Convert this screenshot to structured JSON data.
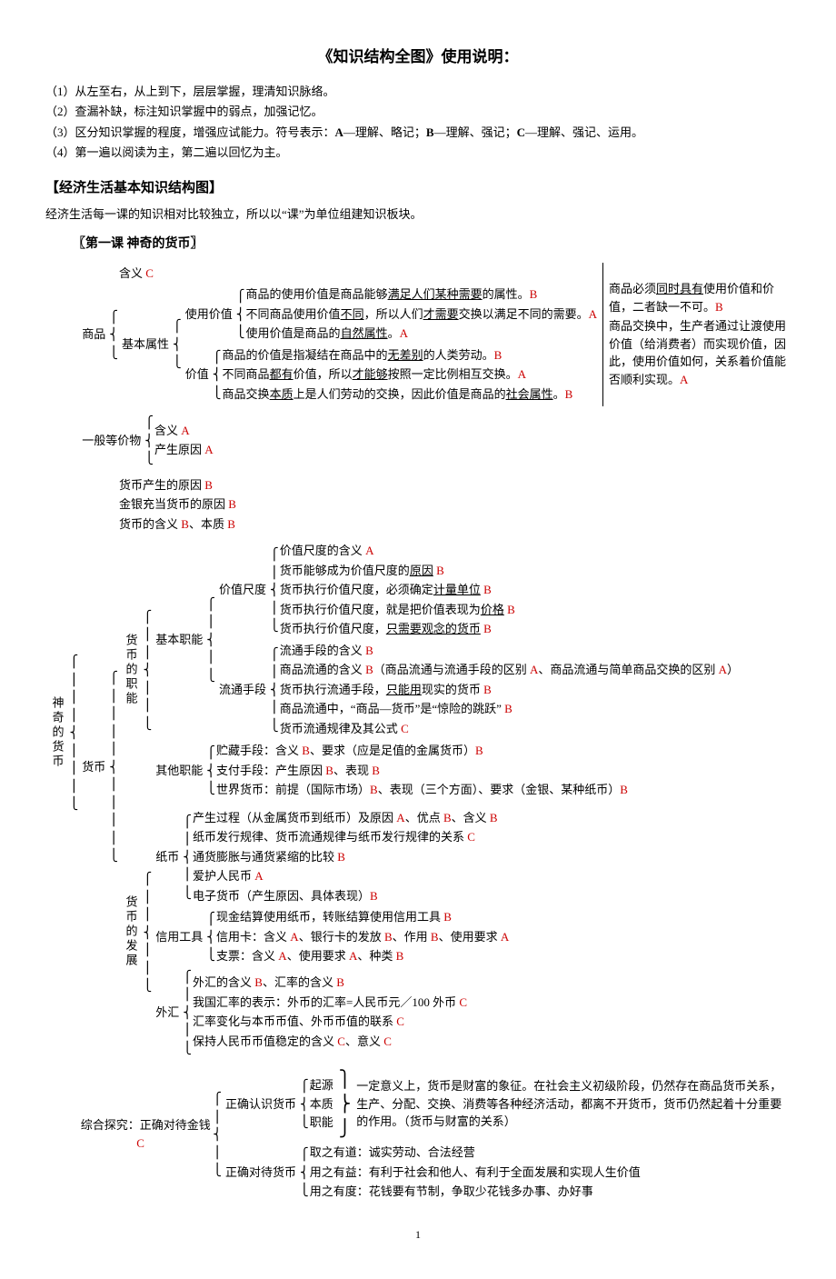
{
  "title": "《知识结构全图》使用说明：",
  "intro": {
    "l1": "（1）从左至右，从上到下，层层掌握，理清知识脉络。",
    "l2": "（2）查漏补缺，标注知识掌握中的弱点，加强记忆。",
    "l3_a": "（3）区分知识掌握的程度，增强应试能力。符号表示：",
    "l3_b": "A",
    "l3_c": "—理解、略记；",
    "l3_d": "B",
    "l3_e": "—理解、强记；",
    "l3_f": "C",
    "l3_g": "—理解、强记、运用。",
    "l4": "（4）第一遍以阅读为主，第二遍以回忆为主。"
  },
  "h2": "【经济生活基本知识结构图】",
  "sub": "经济生活每一课的知识相对比较独立，所以以“课”为单位组建知识板块。",
  "h3": "〖第一课 神奇的货币〗",
  "root": "神奇的货币",
  "commodity": {
    "label": "商品",
    "hy": "含义",
    "hy_c": "C",
    "attr": "基本属性",
    "use": "使用价值",
    "use_l1a": "商品的使用价值是商品能够",
    "use_l1b": "满足人们某种需要",
    "use_l1c": "的属性。",
    "use_l1d": "B",
    "use_l2a": "不同商品使用价值",
    "use_l2b": "不同",
    "use_l2c": "，所以人们",
    "use_l2d": "才需要",
    "use_l2e": "交换以满足不同的需要。",
    "use_l2f": "A",
    "use_l3a": "使用价值是商品的",
    "use_l3b": "自然属性",
    "use_l3c": "。",
    "use_l3d": "A",
    "val": "价值",
    "val_l1a": "商品的价值是指凝结在商品中的",
    "val_l1b": "无差别",
    "val_l1c": "的人类劳动。",
    "val_l1d": "B",
    "val_l2a": "不同商品",
    "val_l2b": "都有",
    "val_l2c": "价值，所以",
    "val_l2d": "才能够",
    "val_l2e": "按照一定比例相互交换。",
    "val_l2f": "A",
    "val_l3a": "商品交换",
    "val_l3b": "本质",
    "val_l3c": "上是人们劳动的交换，因此价值是商品的",
    "val_l3d": "社会属性",
    "val_l3e": "。",
    "val_l3f": "B"
  },
  "sidebox": {
    "p1a": "商品必须",
    "p1b": "同时具有",
    "p1c": "使用价值和价值，二者缺一不可。",
    "p1d": "B",
    "p2a": "商品交换中，生产者通过让渡使用价值（给消费者）而实现价值，因此，使用价值如何，关系着价值能否顺利实现。",
    "p2b": "A"
  },
  "equiv": {
    "label": "一般等价物",
    "l1": "含义",
    "l1c": "A",
    "l2": "产生原因",
    "l2c": "A"
  },
  "money": {
    "label": "货币",
    "orig1": "货币产生的原因",
    "orig1c": "B",
    "orig2": "金银充当货币的原因",
    "orig2c": "B",
    "orig3a": "货币的含义",
    "orig3b": "B",
    "orig3c": "、本质",
    "orig3d": "B",
    "func": "货币的职能",
    "basic": "基本职能",
    "ms": "价值尺度",
    "ms1": "价值尺度的含义",
    "ms1c": "A",
    "ms2a": "货币能够成为价值尺度的",
    "ms2b": "原因",
    "ms2c": "B",
    "ms3a": "货币执行价值尺度，必须确定",
    "ms3b": "计量单位",
    "ms3c": "B",
    "ms4a": "货币执行价值尺度，就是把价值表现为",
    "ms4b": "价格",
    "ms4c": "B",
    "ms5a": "货币执行价值尺度，",
    "ms5b": "只需要观念的货币",
    "ms5c": "B",
    "cir": "流通手段",
    "cir1": "流通手段的含义",
    "cir1c": "B",
    "cir2a": "商品流通的含义",
    "cir2b": "B",
    "cir2c": "（商品流通与流通手段的区别",
    "cir2d": "A",
    "cir2e": "、商品流通与简单商品交换的区别",
    "cir2f": "A",
    "cir2g": "）",
    "cir3a": "货币执行流通手段，",
    "cir3b": "只能用",
    "cir3c": "现实的货币",
    "cir3d": "B",
    "cir4a": "商品流通中，“商品—货币”是“惊险的跳跃”",
    "cir4b": "B",
    "cir5a": "货币流通规律及其公式",
    "cir5b": "C",
    "other": "其他职能",
    "o1a": "贮藏手段：含义",
    "o1b": "B",
    "o1c": "、要求（应是足值的金属货币）",
    "o1d": "B",
    "o2a": "支付手段：产生原因",
    "o2b": "B",
    "o2c": "、表现",
    "o2d": "B",
    "o3a": "世界货币：前提（国际市场）",
    "o3b": "B",
    "o3c": "、表现（三个方面）、要求（金银、某种纸币）",
    "o3d": "B",
    "dev": "货币的发展",
    "paper": "纸币",
    "p1a": "产生过程（从金属货币到纸币）及原因",
    "p1b": "A",
    "p1c": "、优点",
    "p1d": "B",
    "p1e": "、含义",
    "p1f": "B",
    "p2a": "纸币发行规律、货币流通规律与纸币发行规律的关系",
    "p2b": "C",
    "p3a": "通货膨胀与通货紧缩的比较",
    "p3b": "B",
    "p4a": "爱护人民币",
    "p4b": "A",
    "p5a": "电子货币（产生原因、具体表现）",
    "p5b": "B",
    "credit": "信用工具",
    "c1a": "现金结算使用纸币，转账结算使用信用工具",
    "c1b": "B",
    "c2a": "信用卡：含义",
    "c2b": "A",
    "c2c": "、银行卡的发放",
    "c2d": "B",
    "c2e": "、作用",
    "c2f": "B",
    "c2g": "、使用要求",
    "c2h": "A",
    "c3a": "支票：含义",
    "c3b": "A",
    "c3c": "、使用要求",
    "c3d": "A",
    "c3e": "、种类",
    "c3f": "B",
    "fx": "外汇",
    "fx1a": "外汇的含义",
    "fx1b": "B",
    "fx1c": "、汇率的含义",
    "fx1d": "B",
    "fx2a": "我国汇率的表示：外币的汇率=人民币元／100 外币",
    "fx2b": "C",
    "fx3a": "汇率变化与本币币值、外币币值的联系",
    "fx3b": "C",
    "fx4a": "保持人民币币值稳定的含义",
    "fx4b": "C",
    "fx4c": "、意义",
    "fx4d": "C"
  },
  "explore": {
    "label": "综合探究：正确对待金钱",
    "labelc": "C",
    "know": "正确认识货币",
    "k1": "起源",
    "k2": "本质",
    "k3": "职能",
    "kbody": "一定意义上，货币是财富的象征。在社会主义初级阶段，仍然存在商品货币关系，生产、分配、交换、消费等各种经济活动，都离不开货币，货币仍然起着十分重要的作用。（货币与财富的关系）",
    "treat": "正确对待货币",
    "t1": "取之有道：诚实劳动、合法经营",
    "t2": "用之有益：有利于社会和他人、有利于全面发展和实现人生价值",
    "t3": "用之有度：花钱要有节制，争取少花钱多办事、办好事"
  },
  "pagenum": "1"
}
